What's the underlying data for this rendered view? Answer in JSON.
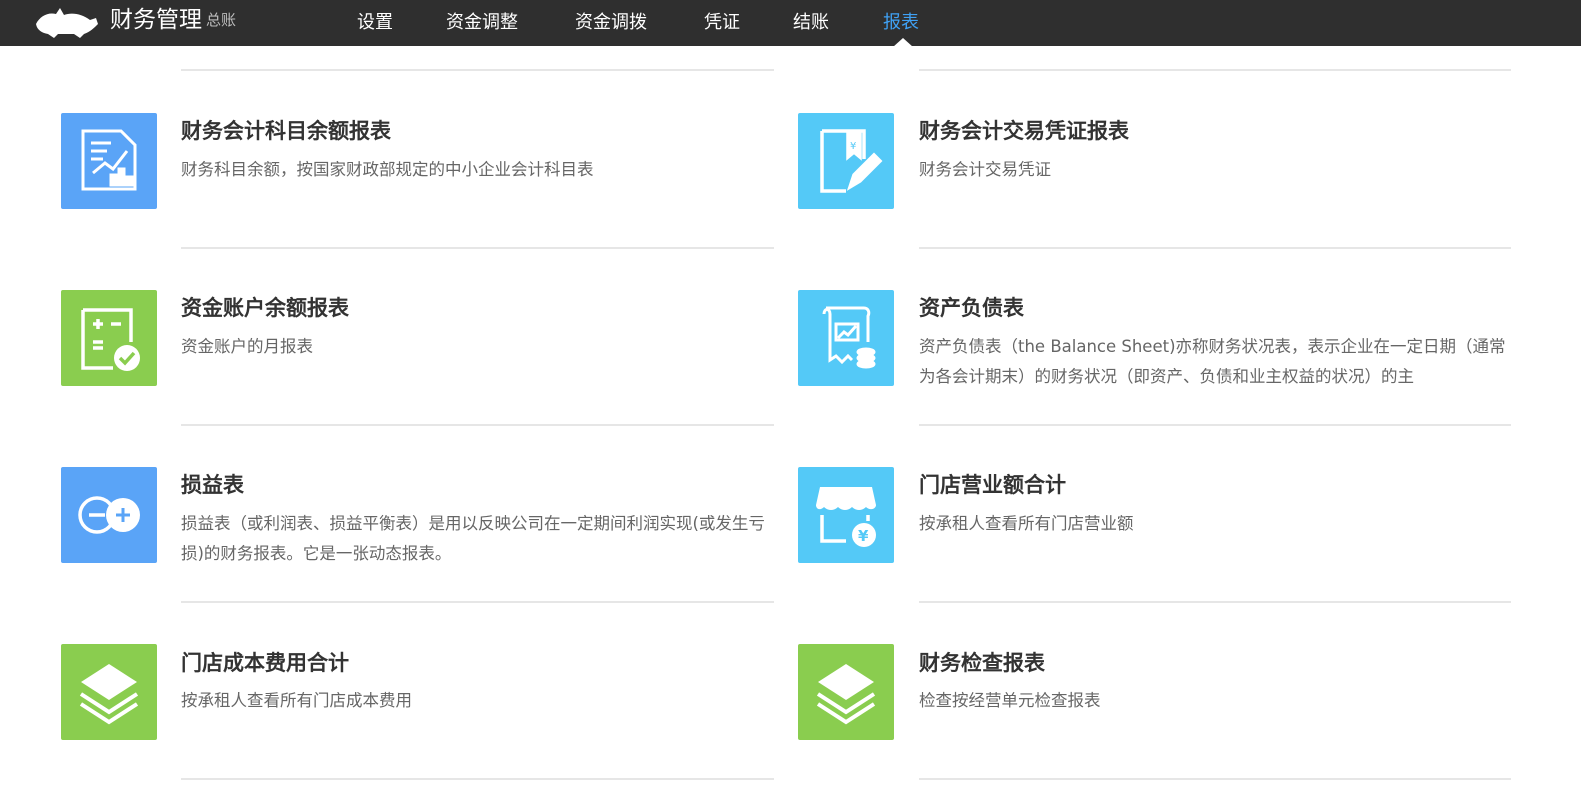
{
  "app": {
    "logo_icon": "rhino-logo-icon",
    "title": "财务管理",
    "subtitle": "总账"
  },
  "nav": {
    "items": [
      {
        "label": "设置"
      },
      {
        "label": "资金调整"
      },
      {
        "label": "资金调拨"
      },
      {
        "label": "凭证"
      },
      {
        "label": "结账"
      },
      {
        "label": "报表",
        "active": true
      }
    ],
    "active_color": "#3fa1f4"
  },
  "reports": [
    {
      "title": "财务会计科目余额报表",
      "desc": "财务科目余额，按国家财政部规定的中小企业会计科目表",
      "icon": "report-chart-icon",
      "color": "#5aa4f7"
    },
    {
      "title": "财务会计交易凭证报表",
      "desc": "财务会计交易凭证",
      "icon": "voucher-book-icon",
      "color": "#54c9f7"
    },
    {
      "title": "资金账户余额报表",
      "desc": "资金账户的月报表",
      "icon": "calculator-check-icon",
      "color": "#8acd4f"
    },
    {
      "title": "资产负债表",
      "desc": "资产负债表（the Balance Sheet)亦称财务状况表，表示企业在一定日期（通常为各会计期末）的财务状况（即资产、负债和业主权益的状况）的主",
      "icon": "balance-sheet-icon",
      "color": "#54c9f7"
    },
    {
      "title": "损益表",
      "desc": "损益表（或利润表、损益平衡表）是用以反映公司在一定期间利润实现(或发生亏损)的财务报表。它是一张动态报表。",
      "icon": "minus-plus-icon",
      "color": "#5aa4f7"
    },
    {
      "title": "门店营业额合计",
      "desc": "按承租人查看所有门店营业额",
      "icon": "store-yen-icon",
      "color": "#54c9f7"
    },
    {
      "title": "门店成本费用合计",
      "desc": "按承租人查看所有门店成本费用",
      "icon": "layers-icon",
      "color": "#8acd4f"
    },
    {
      "title": "财务检查报表",
      "desc": "检查按经营单元检查报表",
      "icon": "layers-icon",
      "color": "#8acd4f"
    }
  ]
}
